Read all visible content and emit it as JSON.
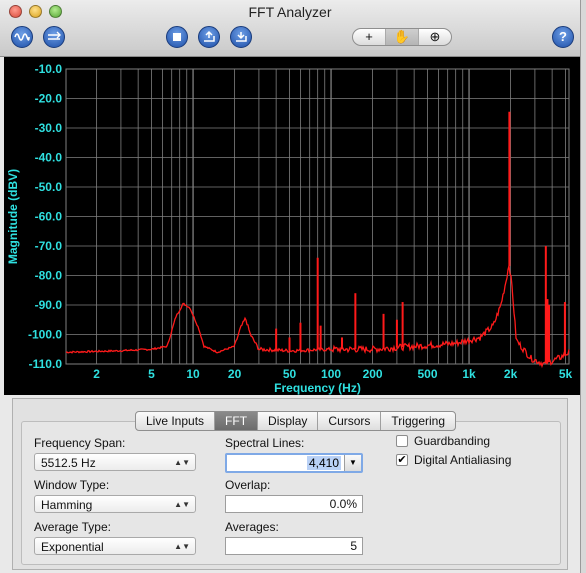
{
  "window": {
    "title": "FFT Analyzer"
  },
  "toolbar": {
    "left_buttons": [
      "waveform-icon",
      "sweep-icon"
    ],
    "center_buttons": [
      "stop-icon",
      "export-icon",
      "import-icon"
    ],
    "tools": [
      {
        "name": "crosshair-icon",
        "glyph": "+"
      },
      {
        "name": "hand-icon",
        "glyph": "✋"
      },
      {
        "name": "zoom-icon",
        "glyph": "⊕"
      }
    ],
    "help_glyph": "?"
  },
  "chart_data": {
    "type": "line",
    "title": "",
    "xlabel": "Frequency (Hz)",
    "ylabel": "Magnitude (dBV)",
    "xscale": "log",
    "xlim": [
      1.2,
      5300
    ],
    "ylim": [
      -110,
      -10
    ],
    "xticks": [
      2,
      5,
      10,
      20,
      50,
      100,
      200,
      500,
      1000,
      2000,
      5000
    ],
    "xtick_labels": [
      "2",
      "5",
      "10",
      "20",
      "50",
      "100",
      "200",
      "500",
      "1k",
      "2k",
      "5k"
    ],
    "yticks": [
      -10,
      -20,
      -30,
      -40,
      -50,
      -60,
      -70,
      -80,
      -90,
      -100,
      -110
    ],
    "ytick_labels": [
      "-10.0",
      "-20.0",
      "-30.0",
      "-40.0",
      "-50.0",
      "-60.0",
      "-70.0",
      "-80.0",
      "-90.0",
      "-100.0",
      "-110.0"
    ],
    "grid": true,
    "colors": {
      "trace": "#ff1a1a",
      "axis_text": "#2fe0e0",
      "grid": "#808080",
      "background": "#000000"
    },
    "baseline": [
      [
        1.2,
        -106
      ],
      [
        3,
        -105.5
      ],
      [
        5,
        -105
      ],
      [
        6.5,
        -104
      ],
      [
        7.5,
        -94
      ],
      [
        8.5,
        -89.5
      ],
      [
        9.5,
        -91
      ],
      [
        11,
        -98
      ],
      [
        12,
        -104
      ],
      [
        15,
        -106
      ],
      [
        20,
        -104
      ],
      [
        22,
        -98
      ],
      [
        24,
        -94.5
      ],
      [
        26,
        -100
      ],
      [
        30,
        -105
      ],
      [
        50,
        -105.5
      ],
      [
        100,
        -105
      ],
      [
        200,
        -105
      ],
      [
        400,
        -104
      ],
      [
        800,
        -103
      ],
      [
        1200,
        -101
      ],
      [
        1500,
        -97
      ],
      [
        1700,
        -90
      ],
      [
        1850,
        -82
      ],
      [
        1950,
        -76
      ],
      [
        2050,
        -84
      ],
      [
        2200,
        -102
      ],
      [
        2800,
        -108
      ],
      [
        3500,
        -110
      ],
      [
        4500,
        -108
      ],
      [
        5300,
        -106
      ]
    ],
    "peaks": [
      [
        40,
        -98
      ],
      [
        50,
        -101
      ],
      [
        60,
        -96
      ],
      [
        80,
        -74
      ],
      [
        84,
        -97
      ],
      [
        120,
        -101
      ],
      [
        150,
        -86
      ],
      [
        240,
        -93
      ],
      [
        300,
        -95
      ],
      [
        330,
        -89
      ],
      [
        1960,
        -24.5
      ],
      [
        3600,
        -70
      ],
      [
        3700,
        -88
      ],
      [
        3800,
        -90
      ],
      [
        4950,
        -89
      ]
    ]
  },
  "tabs": {
    "items": [
      "Live Inputs",
      "FFT",
      "Display",
      "Cursors",
      "Triggering"
    ],
    "active": "FFT"
  },
  "settings": {
    "frequency_span_label": "Frequency Span:",
    "frequency_span_value": "5512.5 Hz",
    "window_type_label": "Window Type:",
    "window_type_value": "Hamming",
    "average_type_label": "Average Type:",
    "average_type_value": "Exponential",
    "spectral_lines_label": "Spectral Lines:",
    "spectral_lines_value": "4,410",
    "overlap_label": "Overlap:",
    "overlap_value": "0.0%",
    "averages_label": "Averages:",
    "averages_value": "5",
    "guardbanding_label": "Guardbanding",
    "guardbanding_checked": false,
    "antialiasing_label": "Digital Antialiasing",
    "antialiasing_checked": true
  }
}
